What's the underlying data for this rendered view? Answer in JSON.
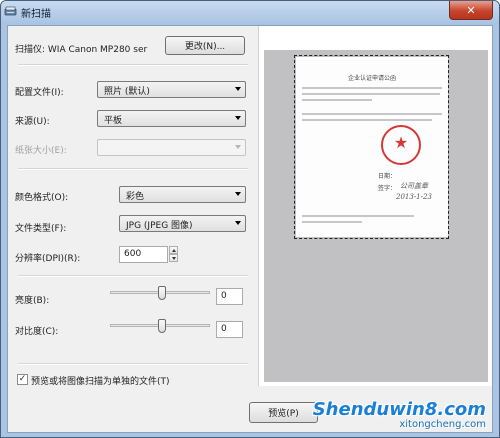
{
  "window": {
    "title": "新扫描",
    "close_label": "✕"
  },
  "scanner": {
    "label": "扫描仪: WIA Canon MP280 ser",
    "change_button": "更改(N)..."
  },
  "form": {
    "profile_label": "配置文件(I):",
    "profile_value": "照片 (默认)",
    "source_label": "来源(U):",
    "source_value": "平板",
    "paper_size_label": "纸张大小(E):",
    "paper_size_value": "",
    "color_format_label": "颜色格式(O):",
    "color_format_value": "彩色",
    "file_type_label": "文件类型(F):",
    "file_type_value": "JPG (JPEG 图像)",
    "resolution_label": "分辨率(DPI)(R):",
    "resolution_value": "600",
    "brightness_label": "亮度(B):",
    "brightness_value": "0",
    "brightness_level": 0,
    "contrast_label": "对比度(C):",
    "contrast_value": "0",
    "contrast_level": 0,
    "separate_files_label": "预览或将图像扫描为单独的文件(T)",
    "separate_files_checked": true
  },
  "buttons": {
    "preview": "预览(P)"
  },
  "preview_doc": {
    "heading": "企业认证申请公函",
    "sign_label_1": "日期：",
    "sign_label_2": "签字：",
    "signature": "公司盖章",
    "date": "2013-1-23"
  },
  "watermark": {
    "main": "Shenduwin8.com",
    "sub": "xitongcheng.com"
  },
  "colors": {
    "accent": "#1a7fd6",
    "stamp": "#d63737",
    "preview_bg": "#c1c1c3"
  }
}
